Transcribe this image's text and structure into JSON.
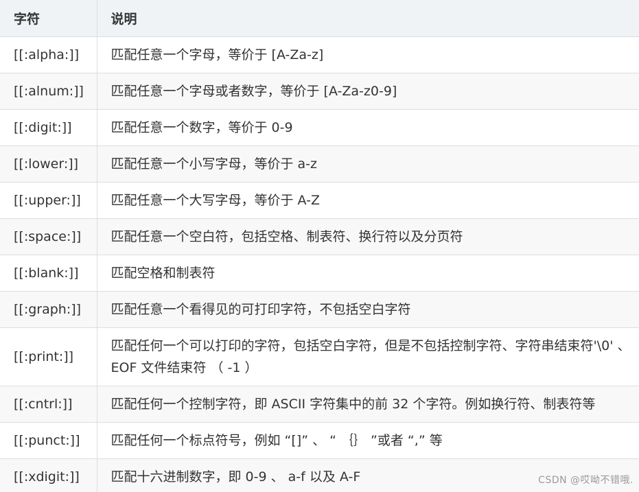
{
  "table": {
    "headers": [
      "字符",
      "说明"
    ],
    "rows": [
      {
        "code": "[[:alpha:]]",
        "desc": "匹配任意一个字母，等价于 [A-Za-z]"
      },
      {
        "code": "[[:alnum:]]",
        "desc": "匹配任意一个字母或者数字，等价于 [A-Za-z0-9]"
      },
      {
        "code": "[[:digit:]]",
        "desc": "匹配任意一个数字，等价于 0-9"
      },
      {
        "code": "[[:lower:]]",
        "desc": "匹配任意一个小写字母，等价于 a-z"
      },
      {
        "code": "[[:upper:]]",
        "desc": "匹配任意一个大写字母，等价于 A-Z"
      },
      {
        "code": "[[:space:]]",
        "desc": "匹配任意一个空白符，包括空格、制表符、换行符以及分页符"
      },
      {
        "code": "[[:blank:]]",
        "desc": "匹配空格和制表符"
      },
      {
        "code": "[[:graph:]]",
        "desc": "匹配任意一个看得见的可打印字符，不包括空白字符"
      },
      {
        "code": "[[:print:]]",
        "desc": "匹配任何一个可以打印的字符，包括空白字符，但是不包括控制字符、字符串结束符'\\0' 、 EOF 文件结束符 （ -1 ）"
      },
      {
        "code": "[[:cntrl:]]",
        "desc": "匹配任何一个控制字符，即 ASCII 字符集中的前 32 个字符。例如换行符、制表符等"
      },
      {
        "code": "[[:punct:]]",
        "desc": "匹配任何一个标点符号，例如 “[]” 、 “ ｛｝ ”或者 “,” 等"
      },
      {
        "code": "[[:xdigit:]]",
        "desc": "匹配十六进制数字，即 0-9 、 a-f 以及 A-F"
      }
    ]
  },
  "watermark": "CSDN @哎呦不错哦."
}
